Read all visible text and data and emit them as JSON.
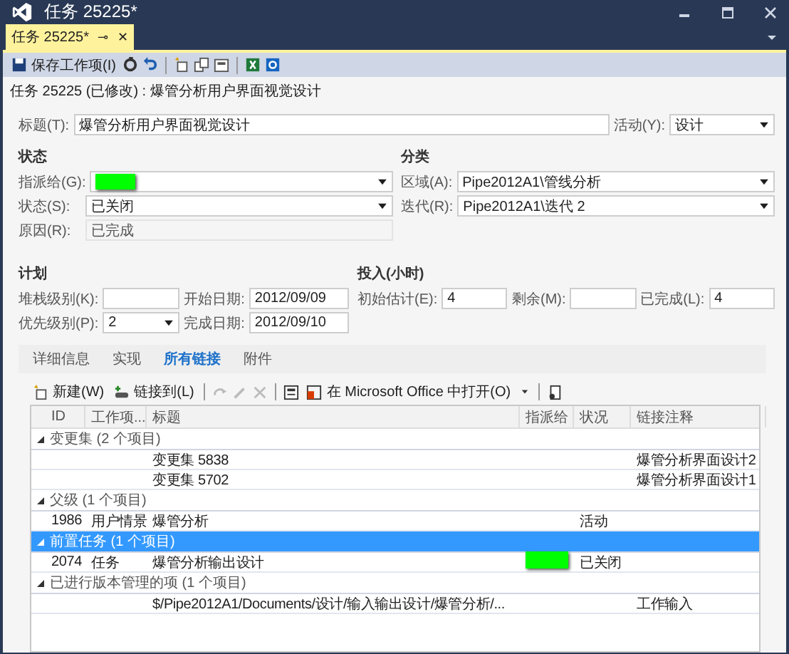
{
  "window": {
    "title": "任务 25225*"
  },
  "doc_tab": {
    "label": "任务 25225*",
    "selected": true,
    "pin": "⊸",
    "close": "✕"
  },
  "toolbar": {
    "save": "保存工作项(I)"
  },
  "header": "任务 25225 (已修改) : 爆管分析用户界面视觉设计",
  "title_field": {
    "label": "标题(T):",
    "value": "爆管分析用户界面视觉设计"
  },
  "activity": {
    "label": "活动(Y):",
    "value": "设计"
  },
  "status_section": {
    "heading": "状态",
    "fields": [
      {
        "label": "指派给(G):",
        "redacted": true,
        "disabled": false
      },
      {
        "label": "状态(S):",
        "value": "已关闭",
        "redacted": false,
        "disabled": false
      },
      {
        "label": "原因(R):",
        "value": "已完成",
        "redacted": false,
        "disabled": true
      }
    ]
  },
  "classification": {
    "heading": "分类",
    "fields": [
      {
        "label": "区域(A):",
        "value": "Pipe2012A1\\管线分析"
      },
      {
        "label": "迭代(R):",
        "value": "Pipe2012A1\\迭代 2"
      }
    ]
  },
  "planning": {
    "heading": "计划",
    "stack_rank": {
      "label": "堆栈级别(K):"
    },
    "priority": {
      "label": "优先级别(P):",
      "value": "2"
    },
    "start": {
      "label": "开始日期:",
      "value": "2012/09/09"
    },
    "finish": {
      "label": "完成日期:",
      "value": "2012/09/10"
    }
  },
  "effort": {
    "heading": "投入(小时)",
    "fields": [
      {
        "label": "初始估计(E):",
        "value": "4"
      },
      {
        "label": "剩余(M):"
      },
      {
        "label": "已完成(L):",
        "value": "4"
      }
    ]
  },
  "tabs": [
    {
      "label": "详细信息",
      "selected": false
    },
    {
      "label": "实现",
      "selected": false
    },
    {
      "label": "所有链接",
      "selected": true
    },
    {
      "label": "附件",
      "selected": false
    }
  ],
  "links_toolbar": {
    "new": "新建(W)",
    "link_to": "链接到(L)",
    "open_office": "在 Microsoft Office 中打开(O)"
  },
  "table": {
    "columns": [
      "ID",
      "工作项...",
      "标题",
      "指派给",
      "状况",
      "链接注释"
    ],
    "groups": [
      {
        "label": "变更集 (2 个项目)",
        "expanded": true,
        "selected": false,
        "rows": [
          {
            "id": "",
            "type": "",
            "title": "变更集 5838",
            "assigned_redacted": false,
            "state": "",
            "comment": "爆管分析界面设计2"
          },
          {
            "id": "",
            "type": "",
            "title": "变更集 5702",
            "assigned_redacted": false,
            "state": "",
            "comment": "爆管分析界面设计1"
          }
        ]
      },
      {
        "label": "父级 (1 个项目)",
        "expanded": true,
        "selected": false,
        "rows": [
          {
            "id": "1986",
            "type": "用户情景",
            "title": "爆管分析",
            "assigned_redacted": false,
            "state": "活动",
            "comment": ""
          }
        ]
      },
      {
        "label": "前置任务 (1 个项目)",
        "expanded": true,
        "selected": true,
        "rows": [
          {
            "id": "2074",
            "type": "任务",
            "title": "爆管分析输出设计",
            "assigned_redacted": true,
            "state": "已关闭",
            "comment": ""
          }
        ]
      },
      {
        "label": "已进行版本管理的项 (1 个项目)",
        "expanded": true,
        "selected": false,
        "rows": [
          {
            "id": "",
            "type": "",
            "title": "$/Pipe2012A1/Documents/设计/输入输出设计/爆管分析/...",
            "assigned_redacted": false,
            "state": "",
            "comment": "工作输入"
          }
        ]
      }
    ]
  }
}
